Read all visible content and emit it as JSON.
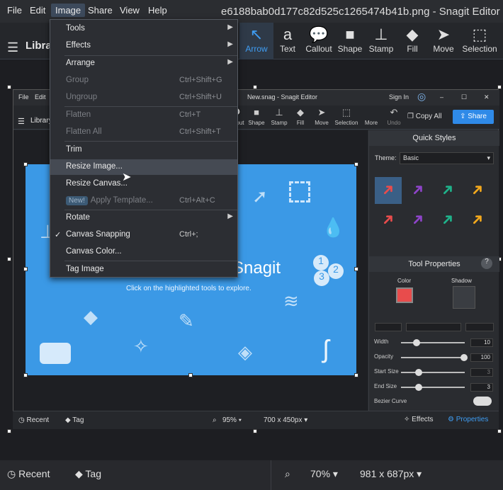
{
  "outer": {
    "menu": [
      "File",
      "Edit",
      "Image",
      "Share",
      "View",
      "Help"
    ],
    "title": "e6188bab0d177c82d525c1265474b41b.png - Snagit Editor",
    "library_label": "Library",
    "tools": [
      {
        "label": "Arrow",
        "icon": "arrow-icon"
      },
      {
        "label": "Text",
        "icon": "text-icon"
      },
      {
        "label": "Callout",
        "icon": "callout-icon"
      },
      {
        "label": "Shape",
        "icon": "shape-icon"
      },
      {
        "label": "Stamp",
        "icon": "stamp-icon"
      },
      {
        "label": "Fill",
        "icon": "fill-icon"
      },
      {
        "label": "Move",
        "icon": "move-icon"
      },
      {
        "label": "Selection",
        "icon": "selection-icon"
      }
    ],
    "status": {
      "recent": "Recent",
      "tag": "Tag",
      "zoom": "70%",
      "size": "981 x 687px"
    }
  },
  "image_menu": {
    "items": [
      {
        "label": "Tools",
        "shortcut": "",
        "submenu": true
      },
      {
        "label": "Effects",
        "shortcut": "",
        "submenu": true
      },
      {
        "label": "Arrange",
        "shortcut": "",
        "submenu": true
      },
      {
        "label": "Group",
        "shortcut": "Ctrl+Shift+G",
        "disabled": true
      },
      {
        "label": "Ungroup",
        "shortcut": "Ctrl+Shift+U",
        "disabled": true
      },
      {
        "label": "Flatten",
        "shortcut": "Ctrl+T",
        "disabled": true
      },
      {
        "label": "Flatten All",
        "shortcut": "Ctrl+Shift+T",
        "disabled": true
      },
      {
        "label": "Trim",
        "shortcut": ""
      },
      {
        "label": "Resize Image...",
        "shortcut": "",
        "highlighted": true
      },
      {
        "label": "Resize Canvas...",
        "shortcut": ""
      },
      {
        "label": "Apply Template...",
        "shortcut": "Ctrl+Alt+C",
        "disabled": true,
        "badge": "New!"
      },
      {
        "label": "Rotate",
        "shortcut": "",
        "submenu": true
      },
      {
        "label": "Canvas Snapping",
        "shortcut": "Ctrl+;",
        "checked": true
      },
      {
        "label": "Canvas Color...",
        "shortcut": ""
      },
      {
        "label": "Tag Image",
        "shortcut": ""
      }
    ]
  },
  "inner": {
    "menu": [
      "File",
      "Edit"
    ],
    "title": "New.snag - Snagit Editor",
    "sign_in": "Sign In",
    "library_label": "Library",
    "tools": [
      "Callout",
      "Shape",
      "Stamp",
      "Fill",
      "Move",
      "Selection",
      "More",
      "Undo"
    ],
    "copy_all": "Copy All",
    "share": "Share",
    "image_heading": "Snagit",
    "image_subtitle": "Click on the highlighted tools to explore.",
    "quick_styles": {
      "title": "Quick Styles",
      "theme_label": "Theme:",
      "theme_value": "Basic"
    },
    "tool_properties": {
      "title": "Tool Properties",
      "color_label": "Color",
      "shadow_label": "Shadow",
      "fill_color": "#e84c4c",
      "sliders": [
        {
          "label": "Width",
          "value": "10",
          "level": 0.2
        },
        {
          "label": "Opacity",
          "value": "100",
          "level": 1.0
        },
        {
          "label": "Start Size",
          "value": "3",
          "level": 0.25
        },
        {
          "label": "End Size",
          "value": "3",
          "level": 0.25
        }
      ],
      "bezier_label": "Bezier Curve"
    },
    "status": {
      "recent": "Recent",
      "tag": "Tag",
      "zoom": "95%",
      "size": "700 x 450px",
      "effects": "Effects",
      "properties": "Properties"
    }
  },
  "colors": {
    "accent": "#3f9df3",
    "image_blue": "#3b99e6"
  }
}
